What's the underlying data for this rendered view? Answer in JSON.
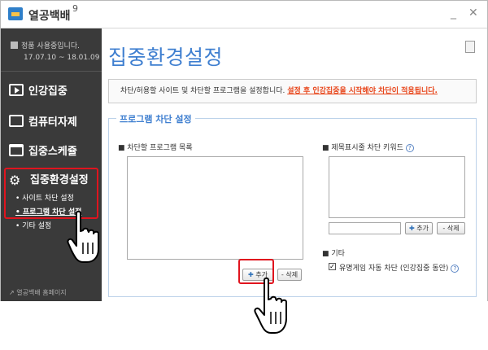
{
  "window": {
    "title": "열공백배",
    "version": "9",
    "controls": {
      "minimize": "_",
      "close": "✕"
    }
  },
  "sidebar": {
    "license": {
      "status": "정품 사용중입니다.",
      "period": "17.07.10 ~ 18.01.09"
    },
    "items": [
      {
        "label": "인강집중",
        "icon": "play-icon"
      },
      {
        "label": "컴퓨터자제",
        "icon": "monitor-icon"
      },
      {
        "label": "집중스케쥴",
        "icon": "calendar-icon"
      },
      {
        "label": "집중환경설정",
        "icon": "gear-icon"
      }
    ],
    "sub_items": [
      {
        "label": "• 사이트 차단 설정",
        "active": false
      },
      {
        "label": "• 프로그램 차단 설정",
        "active": true
      },
      {
        "label": "• 기타 설정",
        "active": false
      }
    ],
    "home_link": "열공백배 홈페이지"
  },
  "main": {
    "title": "집중환경설정",
    "info": {
      "text": "차단/허용할 사이트 및 차단할 프로그램을 설정합니다.",
      "warning": "설정 후 인강집중을 시작해야 차단이 적용됩니다."
    },
    "panel": {
      "legend": "프로그램 차단 설정",
      "program_list_label": "■ 차단할 프로그램 목록",
      "keyword_label": "■ 제목표시줄 차단 키워드",
      "add_label": "추가",
      "delete_label": "삭제",
      "etc_label": "■ 기타",
      "game_block_label": "유명게임 자동 차단 (인강집중 동안)",
      "game_block_checked": true,
      "help_symbol": "?"
    }
  },
  "colors": {
    "accent": "#3f7fd0",
    "warning": "#e8461b",
    "highlight": "#e0141e",
    "sidebar": "#3a3a3a"
  }
}
